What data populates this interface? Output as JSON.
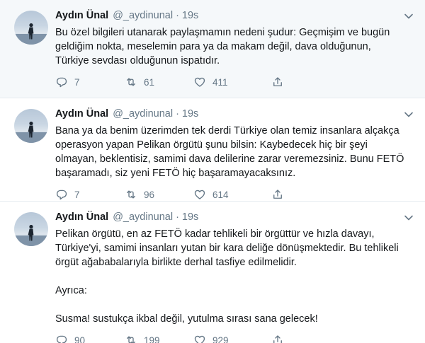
{
  "tweets": [
    {
      "fullname": "Aydın Ünal",
      "username": "@_aydinunal",
      "dot": "·",
      "time": "19s",
      "text": "Bu özel bilgileri utanarak paylaşmamın nedeni şudur: Geçmişim ve bugün\ngeldiğim nokta, meselemin para ya da makam değil, dava olduğunun,\nTürkiye sevdası olduğunun ispatıdır.",
      "replies": "7",
      "retweets": "61",
      "likes": "411"
    },
    {
      "fullname": "Aydın Ünal",
      "username": "@_aydinunal",
      "dot": "·",
      "time": "19s",
      "text": "Bana ya da benim üzerimden tek derdi Türkiye olan temiz insanlara alçakça\noperasyon yapan Pelikan örgütü şunu bilsin: Kaybedecek hiç bir şeyi\nolmayan, beklentisiz, samimi dava delilerine zarar veremezsiniz. Bunu FETÖ\nbaşaramadı, siz yeni FETÖ hiç başaramayacaksınız.",
      "replies": "7",
      "retweets": "96",
      "likes": "614"
    },
    {
      "fullname": "Aydın Ünal",
      "username": "@_aydinunal",
      "dot": "·",
      "time": "19s",
      "text": "Pelikan örgütü, en az FETÖ kadar tehlikeli bir örgüttür ve hızla davayı,\nTürkiye'yi, samimi insanları yutan bir kara deliğe dönüşmektedir. Bu tehlikeli\nörgüt ağababalarıyla birlikte derhal tasfiye edilmelidir.\n\nAyrıca:\n\nSusma! sustukça ikbal değil, yutulma sırası sana gelecek!",
      "replies": "90",
      "retweets": "199",
      "likes": "929"
    }
  ],
  "icons": {
    "reply": "reply-icon",
    "retweet": "retweet-icon",
    "like": "heart-icon",
    "share": "share-icon",
    "caret": "chevron-down-icon"
  },
  "colors": {
    "highlight_bg": "#f5f8fa",
    "secondary_text": "#657786",
    "divider": "#e6ecf0"
  }
}
